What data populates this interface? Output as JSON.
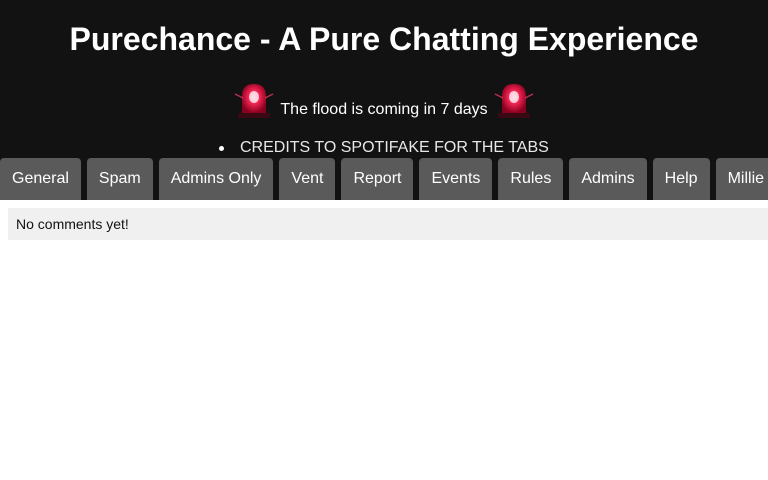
{
  "header": {
    "title": "Purechance - A Pure Chatting Experience",
    "notice": "The flood is coming in 7 days",
    "notice_icon": "siren-icon",
    "credits": "CREDITS TO SPOTIFAKE FOR THE TABS"
  },
  "tabs": [
    {
      "label": "General"
    },
    {
      "label": "Spam"
    },
    {
      "label": "Admins Only"
    },
    {
      "label": "Vent"
    },
    {
      "label": "Report"
    },
    {
      "label": "Events"
    },
    {
      "label": "Rules"
    },
    {
      "label": "Admins"
    },
    {
      "label": "Help"
    },
    {
      "label": "Millie"
    }
  ],
  "comments": {
    "empty_text": "No comments yet!"
  },
  "colors": {
    "header_bg": "#121212",
    "tab_bg": "#5a5a5a",
    "comments_bg": "#f0f0f0",
    "siren_red": "#e0103c"
  }
}
